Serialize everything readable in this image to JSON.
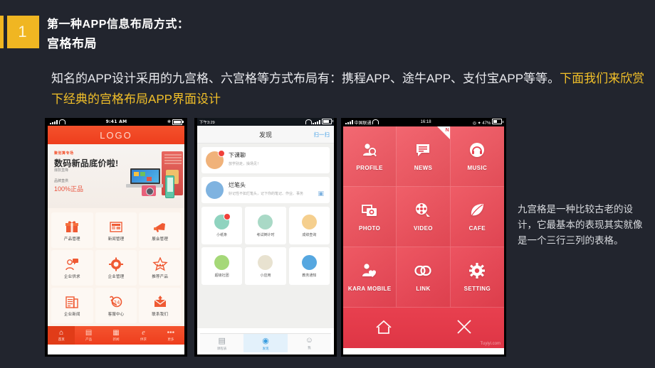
{
  "header": {
    "number": "1",
    "line1": "第一种APP信息布局方式：",
    "line2": "宫格布局"
  },
  "paragraph": {
    "normal": "知名的APP设计采用的九宫格、六宫格等方式布局有：携程APP、途牛APP、支付宝APP等等。",
    "highlight": "下面我们来欣赏下经典的宫格布局APP界面设计"
  },
  "note": "九宫格是一种比较古老的设计，它最基本的表现其实就像是一个三行三列的表格。",
  "phone1": {
    "status": {
      "time": "9:41 AM"
    },
    "logo": "LOGO",
    "banner": {
      "tag": "聚划算专场",
      "title": "数码新品底价啦!",
      "sub": "爆款直降",
      "line1": "品牌直供",
      "line2": "100%正品"
    },
    "grid": [
      {
        "label": "产品管理",
        "icon": "gift-icon"
      },
      {
        "label": "新闻管理",
        "icon": "newspaper-icon"
      },
      {
        "label": "展会管理",
        "icon": "megaphone-icon"
      },
      {
        "label": "企业供求",
        "icon": "person-chat-icon"
      },
      {
        "label": "企业管理",
        "icon": "gear-wrench-icon"
      },
      {
        "label": "推荐产品",
        "icon": "star-crown-icon"
      },
      {
        "label": "企业新闻",
        "icon": "document-icon"
      },
      {
        "label": "客服中心",
        "icon": "phone-24h-icon"
      },
      {
        "label": "联系我们",
        "icon": "envelope-icon"
      }
    ],
    "tabs": [
      {
        "label": "首页",
        "icon": "home-icon",
        "active": true
      },
      {
        "label": "产品",
        "icon": "product-icon",
        "active": false
      },
      {
        "label": "新闻",
        "icon": "news-icon",
        "active": false
      },
      {
        "label": "供求",
        "icon": "ie-icon",
        "active": false
      },
      {
        "label": "更多",
        "icon": "more-dots-icon",
        "active": false
      }
    ]
  },
  "phone2": {
    "status": {
      "time": "下午3:29"
    },
    "nav": {
      "title": "发现",
      "right": "扫一扫"
    },
    "cards": [
      {
        "title": "下课聊",
        "sub": "放学别走，操场见！",
        "icon": "avatar-girl-icon",
        "badge": true
      },
      {
        "title": "烂笔头",
        "sub": "好记性不如烂笔头，记下你的笔记、作业、事务",
        "icon": "pencil-icon",
        "action": "camera-icon"
      }
    ],
    "grid": [
      {
        "label": "小纸条",
        "icon": "paper-plane-icon",
        "badge": true
      },
      {
        "label": "考试倒计时",
        "icon": "clock-icon",
        "badge": false
      },
      {
        "label": "成绩查询",
        "icon": "grade-a-icon",
        "badge": false
      },
      {
        "label": "超级社团",
        "icon": "group-icon",
        "badge": false
      },
      {
        "label": "小应用",
        "icon": "pen-icon",
        "badge": false
      },
      {
        "label": "教务通知",
        "icon": "teach-icon",
        "badge": false
      }
    ],
    "tabs": [
      {
        "label": "课程表",
        "icon": "schedule-icon",
        "active": false
      },
      {
        "label": "发现",
        "icon": "discover-icon",
        "active": true
      },
      {
        "label": "我",
        "icon": "profile-icon",
        "active": false
      }
    ]
  },
  "phone3": {
    "status": {
      "carrier": "中国联通",
      "time": "16:18",
      "battery": "47%"
    },
    "grid": [
      {
        "label": "PROFILE",
        "icon": "profile-search-icon"
      },
      {
        "label": "NEWS",
        "icon": "chat-lines-icon",
        "ribbon": "N"
      },
      {
        "label": "MUSIC",
        "icon": "headphone-icon"
      },
      {
        "label": "PHOTO",
        "icon": "camera-icon"
      },
      {
        "label": "VIDEO",
        "icon": "film-reel-icon"
      },
      {
        "label": "CAFE",
        "icon": "leaf-icon"
      },
      {
        "label": "KARA MOBILE",
        "icon": "person-heart-icon"
      },
      {
        "label": "LINK",
        "icon": "chain-link-icon"
      },
      {
        "label": "SETTING",
        "icon": "gear-icon"
      }
    ],
    "bottom": [
      {
        "icon": "home-outline-icon"
      },
      {
        "icon": "close-x-icon"
      }
    ],
    "watermark": "Tuyiyi.com"
  },
  "colors": {
    "background": "#22252e",
    "accent_yellow": "#f0b622",
    "phone1_orange": "#ee3e1d",
    "phone3_red": "#e8404f",
    "phone2_blue": "#4aa3e8"
  }
}
